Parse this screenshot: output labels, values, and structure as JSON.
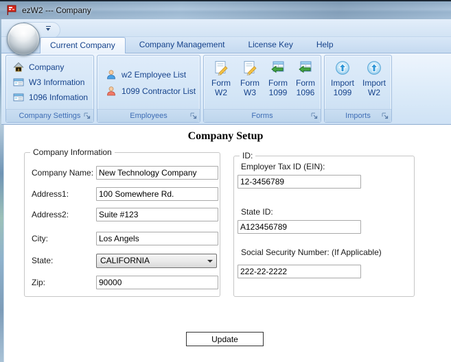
{
  "window": {
    "title": "ezW2 --- Company"
  },
  "tabs": [
    {
      "label": "Current Company"
    },
    {
      "label": "Company Management"
    },
    {
      "label": "License Key"
    },
    {
      "label": "Help"
    }
  ],
  "ribbon": {
    "groups": [
      {
        "caption": "Company Settings",
        "items": [
          {
            "label": "Company",
            "icon": "house-icon"
          },
          {
            "label": "W3 Information",
            "icon": "form-table-icon"
          },
          {
            "label": "1096 Infomation",
            "icon": "form-table-icon"
          }
        ]
      },
      {
        "caption": "Employees",
        "items": [
          {
            "label": "w2 Employee List",
            "icon": "employee-blue-icon"
          },
          {
            "label": "1099 Contractor List",
            "icon": "contractor-red-icon"
          }
        ]
      },
      {
        "caption": "Forms",
        "items": [
          {
            "label1": "Form",
            "label2": "W2",
            "icon": "document-pencil-icon"
          },
          {
            "label1": "Form",
            "label2": "W3",
            "icon": "document-pencil-icon"
          },
          {
            "label1": "Form",
            "label2": "1099",
            "icon": "table-green-arrow-icon"
          },
          {
            "label1": "Form",
            "label2": "1096",
            "icon": "table-green-arrow-icon"
          }
        ]
      },
      {
        "caption": "Imports",
        "items": [
          {
            "label1": "Import",
            "label2": "1099",
            "icon": "circle-up-arrow-icon"
          },
          {
            "label1": "Import",
            "label2": "W2",
            "icon": "circle-up-arrow-icon"
          }
        ]
      }
    ]
  },
  "content": {
    "page_title": "Company Setup",
    "company_info": {
      "legend": "Company Information",
      "fields": [
        {
          "label": "Company Name:",
          "value": "New Technology Company"
        },
        {
          "label": "Address1:",
          "value": "100 Somewhere Rd."
        },
        {
          "label": "Address2:",
          "value": "Suite #123"
        },
        {
          "label": "City:",
          "value": "Los Angels"
        },
        {
          "label": "State:",
          "value": "CALIFORNIA"
        },
        {
          "label": "Zip:",
          "value": "90000"
        }
      ]
    },
    "id_info": {
      "legend": "ID:",
      "fields": [
        {
          "label": "Employer Tax ID (EIN):",
          "value": "12-3456789"
        },
        {
          "label": "State ID:",
          "value": "A123456789"
        },
        {
          "label": "Social Security Number: (If Applicable)",
          "value": "222-22-2222"
        }
      ]
    },
    "update_button": "Update"
  },
  "icons": {
    "app-flag-icon": "red-flag",
    "application-menu-button": "silver-orb",
    "qat-dropdown-icon": "bar-over-down-triangle",
    "house-icon": "house",
    "form-table-icon": "table-document",
    "employee-blue-icon": "person-blue",
    "contractor-red-icon": "person-red",
    "document-pencil-icon": "document-with-pencil",
    "table-green-arrow-icon": "table-with-green-left-arrow",
    "circle-up-arrow-icon": "blue-circle-up-arrow",
    "dialog-launcher-icon": "corner-arrow",
    "combobox-arrow-icon": "down-triangle"
  },
  "colors": {
    "tab_text": "#15428b",
    "group_caption_text": "#3e6db5",
    "flag_red": "#d42a1e",
    "titlebar_top_border": "#1c2733"
  }
}
